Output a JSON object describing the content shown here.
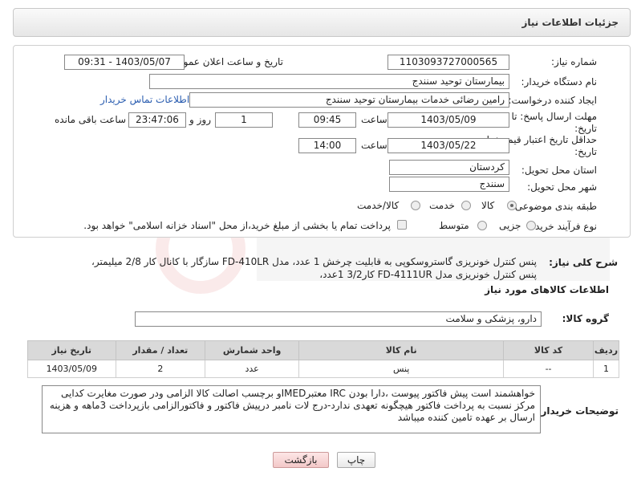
{
  "header": {
    "title": "جزئیات اطلاعات نیاز"
  },
  "form": {
    "need_number": {
      "label": "شماره نیاز:",
      "value": "1103093727000565"
    },
    "announce": {
      "label": "تاریخ و ساعت اعلان عمومی:",
      "value": "1403/05/07 - 09:31"
    },
    "buyer_org": {
      "label": "نام دستگاه خریدار:",
      "value": "بیمارستان توحید سنندج"
    },
    "requester": {
      "label": "ایجاد کننده درخواست:",
      "value": "رامین رضائی خدمات بیمارستان توحید سنندج",
      "contact_link": "اطلاعات تماس خریدار"
    },
    "deadline": {
      "label_line1": "مهلت ارسال پاسخ: تا",
      "label_line2": "تاریخ:",
      "date": "1403/05/09",
      "time_label": "ساعت",
      "time": "09:45",
      "days": "1",
      "days_label": "روز و",
      "remaining": "23:47:06",
      "remaining_label": "ساعت باقی مانده"
    },
    "validity": {
      "label_line1": "حداقل تاریخ اعتبار قیمت: تا",
      "label_line2": "تاریخ:",
      "date": "1403/05/22",
      "time_label": "ساعت",
      "time": "14:00"
    },
    "province": {
      "label": "استان محل تحویل:",
      "value": "کردستان"
    },
    "city": {
      "label": "شهر محل تحویل:",
      "value": "سنندج"
    },
    "category": {
      "label": "طبقه بندی موضوعی:",
      "options": [
        "کالا",
        "خدمت",
        "کالا/خدمت"
      ],
      "selected": "کالا"
    },
    "process": {
      "label": "نوع فرآیند خرید :",
      "options": [
        "جزیی",
        "متوسط"
      ],
      "checkbox_label": "پرداخت تمام یا بخشی از مبلغ خرید،از محل \"اسناد خزانه اسلامی\" خواهد بود."
    }
  },
  "description": {
    "label": "شرح کلی نیاز:",
    "line1": "پنس کنترل خونریزی گاستروسکوپی به قابلیت چرخش 1 عدد، مدل  FD-410LR سازگار با کانال کار 2/8 میلیمتر،",
    "line2": "پنس کنترل خونریزی مدل  FD-4111UR کار3/2 1عدد،"
  },
  "goods": {
    "section_title": "اطلاعات کالاهای مورد نیاز",
    "group_label": "گروه کالا:",
    "group_value": "دارو، پزشکی و سلامت",
    "columns": [
      "ردیف",
      "کد کالا",
      "نام کالا",
      "واحد شمارش",
      "تعداد / مقدار",
      "تاریخ نیاز"
    ],
    "rows": [
      {
        "row": "1",
        "code": "--",
        "name": "پنس",
        "unit": "عدد",
        "qty": "2",
        "date": "1403/05/09"
      }
    ]
  },
  "buyer_notes": {
    "label": "توضیحات خریدار:",
    "text": "خواهشمند است پیش فاکتور پیوست ،دارا بودن IRC معتبرIMEDو برچسب اصالت کالا الزامی ودر صورت مغایرت کدایی مرکز نسبت به پرداخت فاکتور هیچگونه تعهدی ندارد-درج لات نامبر درپیش فاکتور و فاکتورالزامی  بازپرداخت 3ماهه و هزینه ارسال بر عهده تامین کننده میباشد"
  },
  "buttons": {
    "print": "چاپ",
    "back": "بازگشت"
  },
  "colors": {
    "link": "#2a5db0",
    "table_header": "#d9d9d9",
    "back_button": "#f3c8c8"
  }
}
